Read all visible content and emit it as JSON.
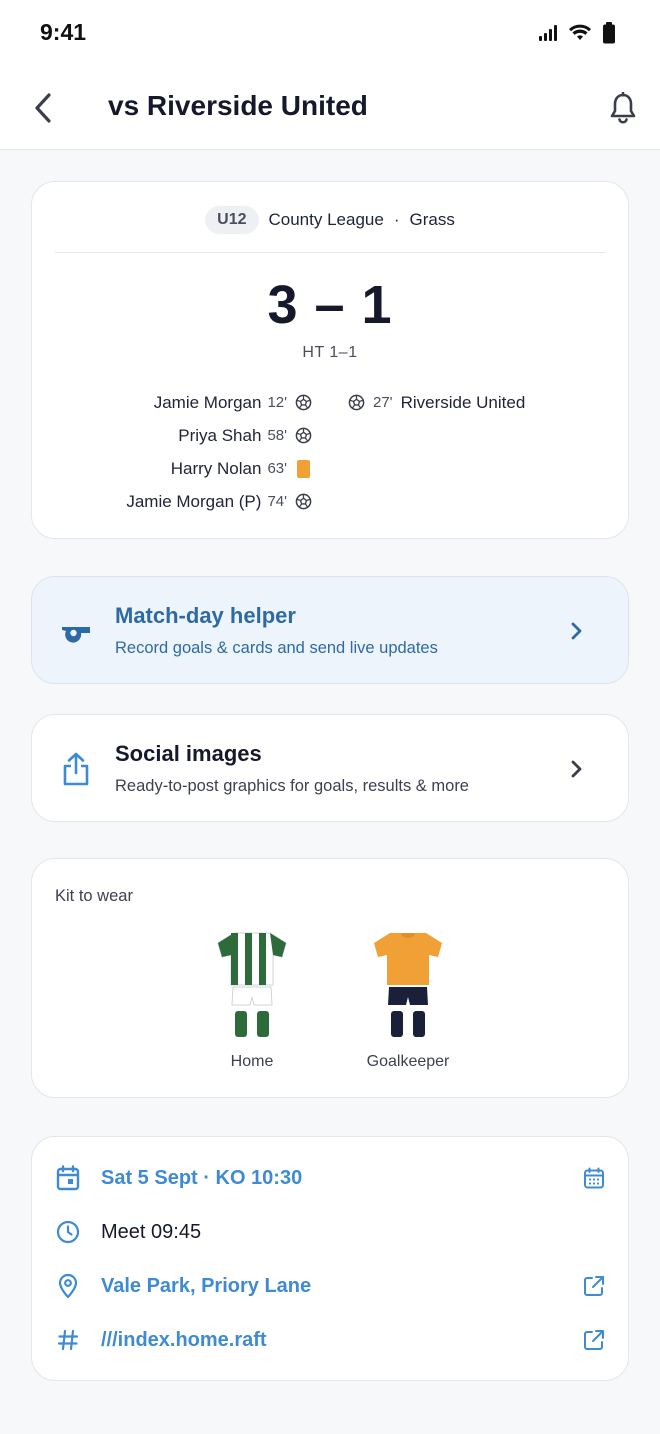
{
  "status_bar": {
    "time": "9:41"
  },
  "header": {
    "title": "vs Riverside United"
  },
  "match": {
    "age_group": "U12",
    "competition": "County League",
    "separator": "·",
    "surface": "Grass",
    "score": "3 – 1",
    "half_time": "HT 1–1",
    "home_events": [
      {
        "player": "Jamie Morgan",
        "minute": "12'",
        "type": "goal"
      },
      {
        "player": "Priya Shah",
        "minute": "58'",
        "type": "goal"
      },
      {
        "player": "Harry Nolan",
        "minute": "63'",
        "type": "yellow-card"
      },
      {
        "player": "Jamie Morgan (P)",
        "minute": "74'",
        "type": "goal"
      }
    ],
    "away_events": [
      {
        "player": "Riverside United",
        "minute": "27'",
        "type": "goal"
      }
    ]
  },
  "helper": {
    "title": "Match-day helper",
    "subtitle": "Record goals & cards and send live updates",
    "icon": "whistle-icon"
  },
  "social": {
    "title": "Social images",
    "subtitle": "Ready-to-post graphics for goals, results & more",
    "icon": "share-icon"
  },
  "kit": {
    "title": "Kit to wear",
    "items": [
      {
        "label": "Home",
        "colors": {
          "shirt_primary": "#2e6b3a",
          "shirt_secondary": "#ffffff",
          "shorts": "#ffffff",
          "socks": "#2e6b3a"
        }
      },
      {
        "label": "Goalkeeper",
        "colors": {
          "shirt_primary": "#f0a035",
          "shorts": "#1a1f3a",
          "socks": "#1a1f3a"
        }
      }
    ]
  },
  "details": {
    "date": "Sat 5 Sept",
    "kickoff": "KO 10:30",
    "date_sep": "·",
    "meet": "Meet 09:45",
    "venue": "Vale Park, Priory Lane",
    "what3words": "///index.home.raft"
  },
  "colors": {
    "accent": "#3e8bd4",
    "helper_text": "#2d6aa3",
    "helper_bg": "#eef4fb",
    "card_yellow": "#f0a035"
  }
}
